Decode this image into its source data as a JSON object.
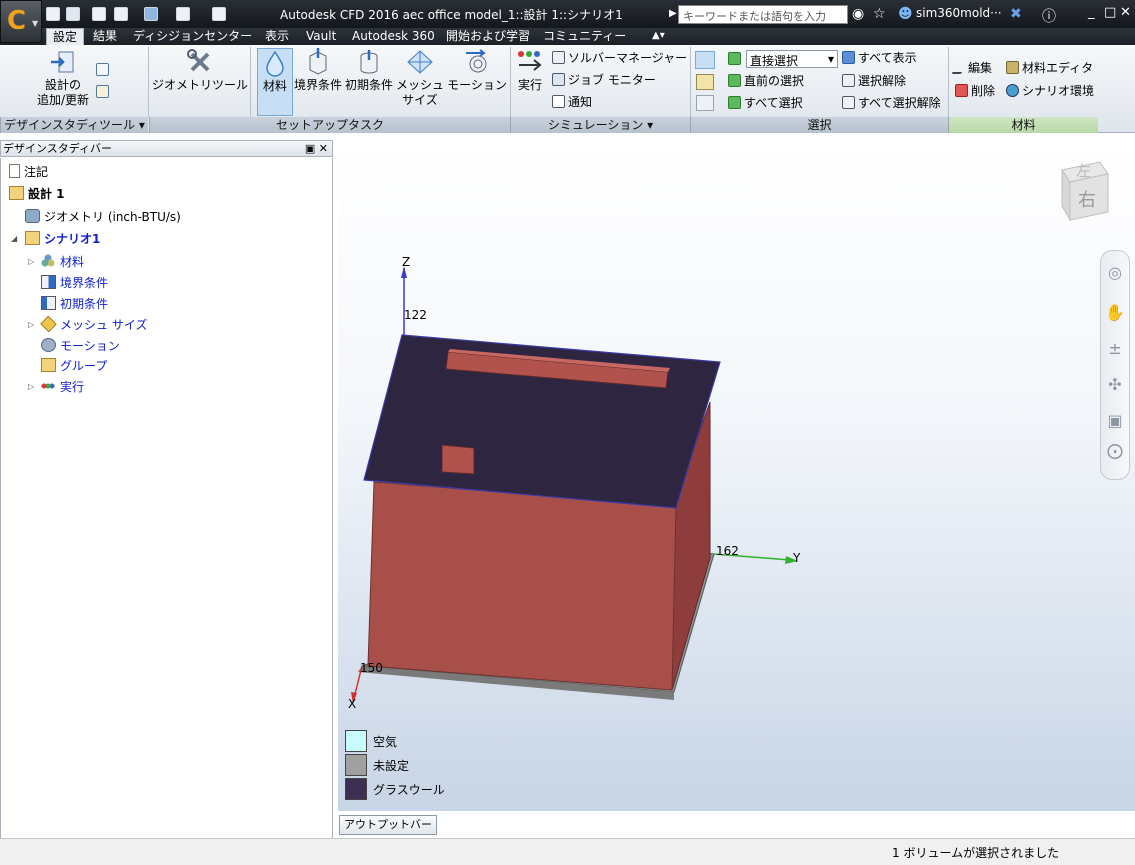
{
  "app": {
    "window_title": "Autodesk CFD 2016   aec office model_1::設計 1::シナリオ1",
    "search_placeholder": "キーワードまたは語句を入力",
    "user_name": "sim360mold···"
  },
  "tabs": [
    {
      "label": "設定",
      "active": true
    },
    {
      "label": "結果"
    },
    {
      "label": "ディシジョンセンター"
    },
    {
      "label": "表示"
    },
    {
      "label": "Vault"
    },
    {
      "label": "Autodesk 360"
    },
    {
      "label": "開始および学習"
    },
    {
      "label": "コミュニティー"
    }
  ],
  "ribbon": {
    "design_tools": {
      "footer": "デザインスタディツール",
      "update_design_line1": "設計の",
      "update_design_line2": "追加/更新"
    },
    "setup": {
      "footer": "セットアップタスク",
      "geometry_tools": "ジオメトリツール",
      "materials": "材料",
      "boundary_conditions": "境界条件",
      "initial_conditions": "初期条件",
      "mesh_size_line1": "メッシュ",
      "mesh_size_line2": "サイズ",
      "motion": "モーション"
    },
    "simulation": {
      "footer": "シミュレーション",
      "run": "実行",
      "solver_manager": "ソルバーマネージャー",
      "job_monitor": "ジョブ モニター",
      "notify": "通知"
    },
    "selection": {
      "footer": "選択",
      "mode": "直接選択",
      "previous": "直前の選択",
      "select_all": "すべて選択",
      "show_all": "すべて表示",
      "deselect": "選択解除",
      "deselect_all": "すべて選択解除"
    },
    "materials": {
      "footer": "材料",
      "edit": "編集",
      "delete": "削除",
      "material_editor": "材料エディタ",
      "scenario_env": "シナリオ環境"
    }
  },
  "design_study_bar": {
    "title": "デザインスタディバー",
    "nodes": {
      "notes": "注記",
      "design": "設計 1",
      "geometry": "ジオメトリ (inch-BTU/s)",
      "scenario": "シナリオ1",
      "materials": "材料",
      "boundary": "境界条件",
      "initial": "初期条件",
      "mesh": "メッシュ サイズ",
      "motion": "モーション",
      "groups": "グループ",
      "run": "実行"
    }
  },
  "viewport": {
    "viewcube_top": "左",
    "viewcube_front": "右",
    "axis_z": "Z",
    "axis_y": "Y",
    "axis_x": "X",
    "dim_z": "122",
    "dim_y": "162",
    "dim_x": "150",
    "legend": [
      {
        "label": "空気",
        "color": "#c8fcfc"
      },
      {
        "label": "未設定",
        "color": "#a0a0a0"
      },
      {
        "label": "グラスウール",
        "color": "#3c2f52"
      }
    ]
  },
  "output_bar": "アウトプットバー",
  "status": "1 ボリュームが選択されました",
  "colors": {
    "wall": "#a84f4a",
    "roof": "#2e2641",
    "base": "#8f8f8f"
  }
}
